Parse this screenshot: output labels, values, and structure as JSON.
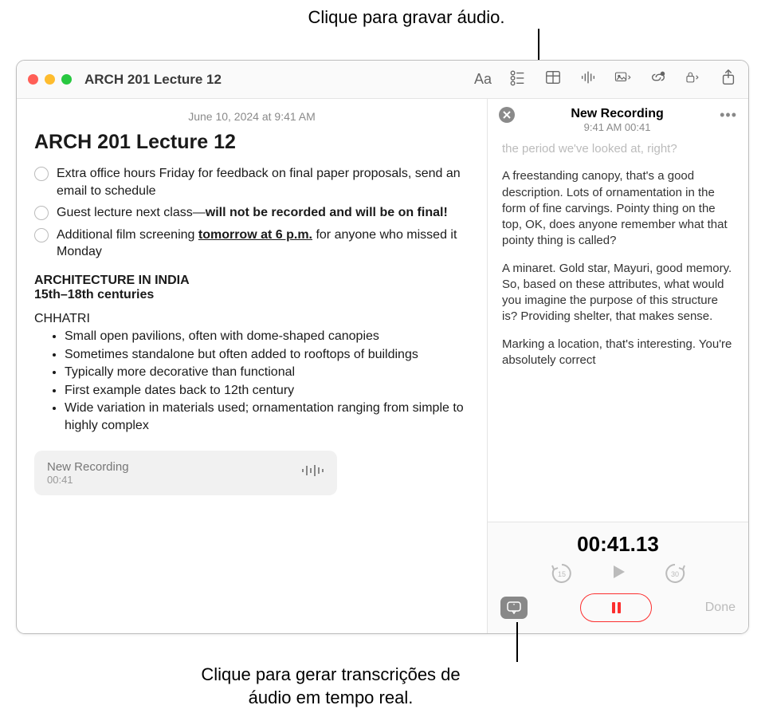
{
  "callouts": {
    "top": "Clique para gravar áudio.",
    "bottom": "Clique para gerar transcrições de áudio em tempo real."
  },
  "window": {
    "title": "ARCH 201 Lecture 12"
  },
  "note": {
    "timestamp": "June 10, 2024 at 9:41 AM",
    "heading": "ARCH 201 Lecture 12",
    "checklist": [
      {
        "text_pre": "Extra office hours Friday for feedback on final paper proposals, send an email to schedule",
        "bold": "",
        "text_post": ""
      },
      {
        "text_pre": "Guest lecture next class—",
        "bold": "will not be recorded and will be on final!",
        "text_post": ""
      },
      {
        "text_pre": "Additional film screening ",
        "bold_u": "tomorrow at 6 p.m.",
        "text_post": " for anyone who missed it Monday"
      }
    ],
    "section_title": "ARCHITECTURE IN INDIA",
    "section_sub": "15th–18th centuries",
    "sub_head": "CHHATRI",
    "bullets": [
      "Small open pavilions, often with dome-shaped canopies",
      "Sometimes standalone but often added to rooftops of buildings",
      "Typically more decorative than functional",
      "First example dates back to 12th century",
      "Wide variation in materials used; ornamentation ranging from simple to highly complex"
    ],
    "rec_card": {
      "title": "New Recording",
      "duration": "00:41"
    }
  },
  "side": {
    "title": "New Recording",
    "time": "9:41 AM 00:41",
    "faded_line": "the period we've looked at, right?",
    "paragraphs": [
      "A freestanding canopy, that's a good description. Lots of ornamentation in the form of fine carvings. Pointy thing on the top, OK, does anyone remember what that pointy thing is called?",
      "A minaret. Gold star, Mayuri, good memory. So, based on these attributes, what would you imagine the purpose of this structure is? Providing shelter, that makes sense.",
      "Marking a location, that's interesting. You're absolutely correct"
    ]
  },
  "controls": {
    "clock": "00:41.13",
    "skip_back": "15",
    "skip_fwd": "30",
    "done": "Done"
  }
}
